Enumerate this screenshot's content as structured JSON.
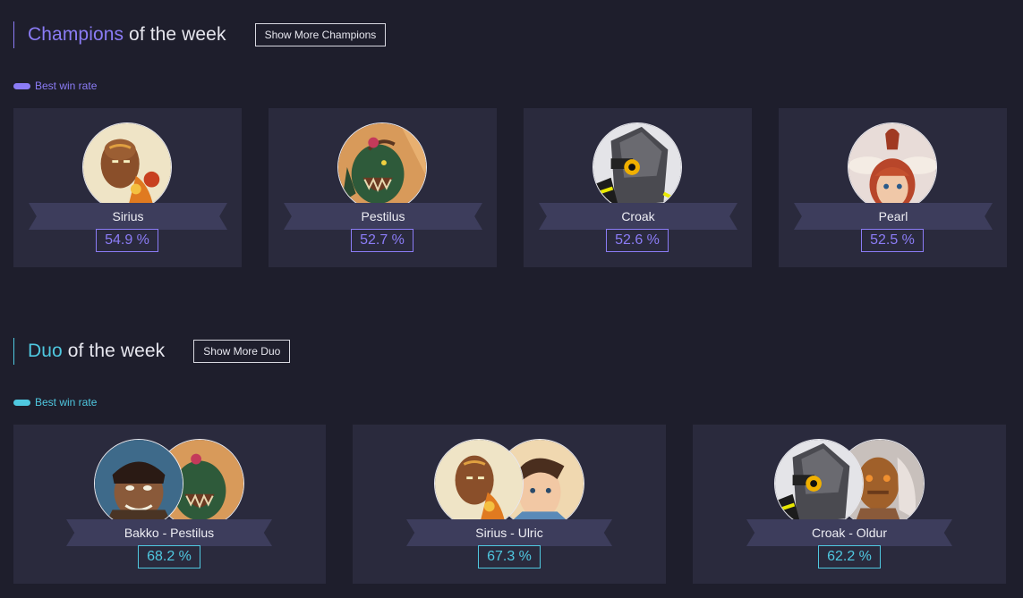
{
  "champions": {
    "title_highlight": "Champions",
    "title_rest": " of the week",
    "more_button": "Show More Champions",
    "badge": "Best win rate",
    "cards": [
      {
        "name": "Sirius",
        "rate": "54.9 %",
        "portrait": "sirius-portrait-icon"
      },
      {
        "name": "Pestilus",
        "rate": "52.7 %",
        "portrait": "pestilus-portrait-icon"
      },
      {
        "name": "Croak",
        "rate": "52.6 %",
        "portrait": "croak-portrait-icon"
      },
      {
        "name": "Pearl",
        "rate": "52.5 %",
        "portrait": "pearl-portrait-icon"
      }
    ]
  },
  "duos": {
    "title_highlight": "Duo",
    "title_rest": " of the week",
    "more_button": "Show More Duo",
    "badge": "Best win rate",
    "cards": [
      {
        "name": "Bakko - Pestilus",
        "rate": "68.2 %",
        "portraits": [
          "bakko-portrait-icon",
          "pestilus-portrait-icon"
        ]
      },
      {
        "name": "Sirius - Ulric",
        "rate": "67.3 %",
        "portraits": [
          "sirius-portrait-icon",
          "ulric-portrait-icon"
        ]
      },
      {
        "name": "Croak - Oldur",
        "rate": "62.2 %",
        "portraits": [
          "croak-portrait-icon",
          "oldur-portrait-icon"
        ]
      }
    ]
  },
  "colors": {
    "background": "#1e1e2c",
    "card": "#2a2a3d",
    "ribbon": "#3d3d5c",
    "accent_purple": "#8b7cf6",
    "accent_cyan": "#4fc8e0"
  }
}
